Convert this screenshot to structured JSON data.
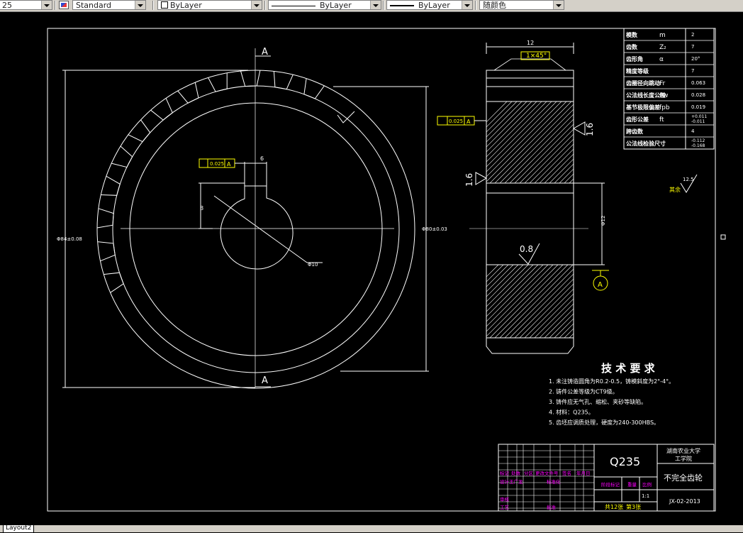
{
  "toolbar": {
    "dimscale_value": "25",
    "textstyle_value": "Standard",
    "color_value": "ByLayer",
    "linetype_value": "ByLayer",
    "lineweight_value": "ByLayer",
    "plotstyle_value": "随颜色"
  },
  "drawing": {
    "section_mark_top": "A",
    "section_mark_bottom": "A",
    "key_tolerance_frame": [
      "0.025",
      "A"
    ],
    "key_width_dim": "6",
    "key_depth_dim": "8",
    "bore_dim": "Φ10",
    "outer_dia_dim_left": "Φ84±0.08",
    "outer_dia_dim_right": "Φ80±0.03",
    "width_dim": "12",
    "chamfer_dim": "1×45°",
    "runout_frame": [
      "0.025",
      "A"
    ],
    "roughness_right_side": "1.6",
    "roughness_left_side": "1.6",
    "roughness_bore": "0.8",
    "hub_dia_dim": "Φ12",
    "datum_label": "A",
    "roughness_general_value": "12.5",
    "roughness_general_note": "其余"
  },
  "param_table": [
    {
      "label": "模数",
      "sym": "m",
      "value": "2"
    },
    {
      "label": "齿数",
      "sym": "Z₂",
      "value": "7"
    },
    {
      "label": "齿形角",
      "sym": "α",
      "value": "20°"
    },
    {
      "label": "精度等级",
      "sym": "",
      "value": "7"
    },
    {
      "label": "齿圈径向跳动",
      "sym": "Fr",
      "value": "0.063"
    },
    {
      "label": "公法线长度公差",
      "sym": "Fw",
      "value": "0.028"
    },
    {
      "label": "基节极限偏差",
      "sym": "fpb",
      "value": "0.019"
    },
    {
      "label": "齿形公差",
      "sym": "ft",
      "value": "+0.011 -0.011"
    },
    {
      "label": "跨齿数",
      "sym": "",
      "value": "4"
    },
    {
      "label": "公法线检验尺寸",
      "sym": "",
      "value": "-0.112 -0.168"
    }
  ],
  "tech_req": {
    "title": "技 术 要 求",
    "items": [
      "1. 未注铸造圆角为R0.2-0.5，铸模斜度为2°-4°。",
      "2. 铸件公差等级为CT9级。",
      "3. 铸件应无气孔、缩松、夹砂等缺陷。",
      "4. 材料：Q235。",
      "5. 齿坯应调质处理，硬度为240-300HBS。"
    ]
  },
  "title_block": {
    "material": "Q235",
    "school": "湖南农业大学",
    "school_sub": "工学院",
    "part_name": "不完全齿轮",
    "drawing_no": "JX-02-2013",
    "scale": "1:1",
    "sheets_total": "共12张",
    "sheet_no": "第3张",
    "labels_row1": [
      "标记",
      "处数",
      "分区",
      "更改文件号",
      "签名",
      "年月日"
    ],
    "labels_row2": [
      "设计",
      "王广龙",
      "标准化"
    ],
    "labels_row3": [
      "阶段标记",
      "重量",
      "比例"
    ],
    "labels_row4": [
      "审核"
    ],
    "labels_row5": [
      "工艺",
      "批准"
    ]
  },
  "tabs": {
    "layout": "Layout2"
  }
}
